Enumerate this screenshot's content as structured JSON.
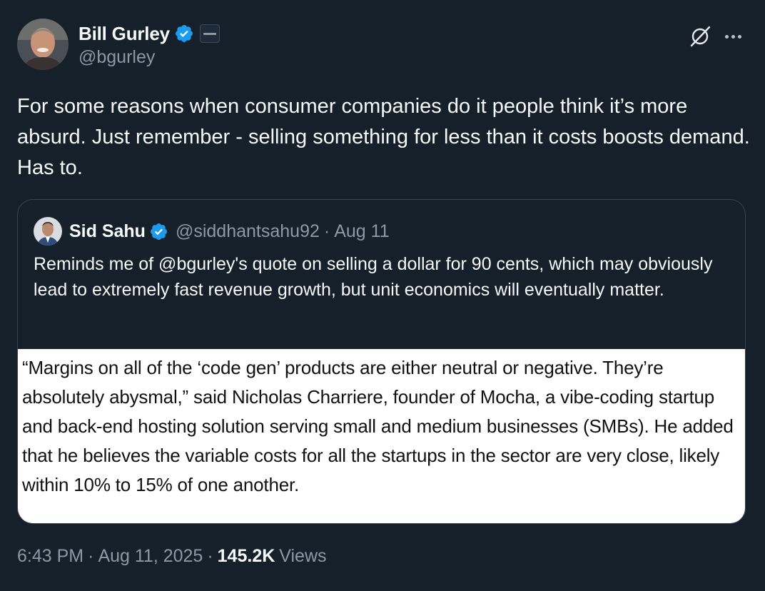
{
  "author": {
    "name": "Bill Gurley",
    "handle": "@bgurley"
  },
  "tweet": {
    "text": "For some reasons when consumer companies do it people think it’s more absurd. Just remember - selling something for less than it costs boosts demand. Has to."
  },
  "quoted_tweet": {
    "name": "Sid Sahu",
    "handle": "@siddhantsahu92",
    "separator": "·",
    "date": "Aug 11",
    "text": "Reminds me of @bgurley's quote on selling a dollar for 90 cents, which may obviously lead to extremely fast revenue growth, but unit economics will eventually matter.",
    "image_text": "“Margins on all of the ‘code gen’ products are either neutral or negative. They’re absolutely abysmal,” said Nicholas Charriere, founder of Mocha, a vibe-coding startup and back-end hosting solution serving small and medium businesses (SMBs). He added that he believes the variable costs for all the startups in the sector are very close, likely within 10% to 15% of one another."
  },
  "meta": {
    "time": "6:43 PM",
    "separator": "·",
    "date": "Aug 11, 2025",
    "views_count": "145.2K",
    "views_label": "Views"
  },
  "icons": {
    "verified": "verified-badge-icon",
    "affiliate": "affiliate-badge-icon",
    "grok": "grok-icon",
    "more": "more-options-icon"
  },
  "colors": {
    "background": "#15202b",
    "verified_blue": "#1d9bf0",
    "secondary_text": "#8b98a5",
    "border": "#38444d"
  }
}
